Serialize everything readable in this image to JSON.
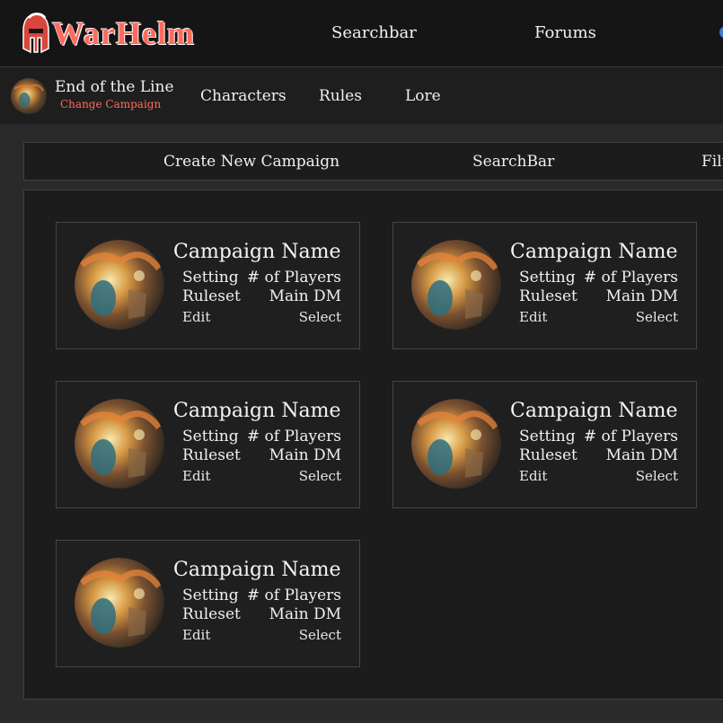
{
  "header": {
    "logo_text": "WarHelm",
    "nav": {
      "searchbar": "Searchbar",
      "forums": "Forums"
    }
  },
  "campaign_bar": {
    "title": "End of the Line",
    "change_label": "Change Campaign",
    "nav": {
      "characters": "Characters",
      "rules": "Rules",
      "lore": "Lore"
    }
  },
  "actions": {
    "create": "Create New Campaign",
    "search": "SearchBar",
    "filter": "Filter"
  },
  "cards": [
    {
      "name": "Campaign Name",
      "setting": "Setting",
      "players": "# of Players",
      "ruleset": "Ruleset",
      "dm": "Main DM",
      "edit": "Edit",
      "select": "Select"
    },
    {
      "name": "Campaign Name",
      "setting": "Setting",
      "players": "# of Players",
      "ruleset": "Ruleset",
      "dm": "Main DM",
      "edit": "Edit",
      "select": "Select"
    },
    {
      "name": "Campaign Name",
      "setting": "Setting",
      "players": "# of Players",
      "ruleset": "Ruleset",
      "dm": "Main DM",
      "edit": "Edit",
      "select": "Select"
    },
    {
      "name": "Campaign Name",
      "setting": "Setting",
      "players": "# of Players",
      "ruleset": "Ruleset",
      "dm": "Main DM",
      "edit": "Edit",
      "select": "Select"
    },
    {
      "name": "Campaign Name",
      "setting": "Setting",
      "players": "# of Players",
      "ruleset": "Ruleset",
      "dm": "Main DM",
      "edit": "Edit",
      "select": "Select"
    }
  ],
  "colors": {
    "accent": "#ff6a5c",
    "background": "#2a2a2a",
    "panel": "#1c1c1c"
  },
  "icons": {
    "logo": "spartan-helmet-icon",
    "card_image": "fantasy-cave-artwork"
  }
}
